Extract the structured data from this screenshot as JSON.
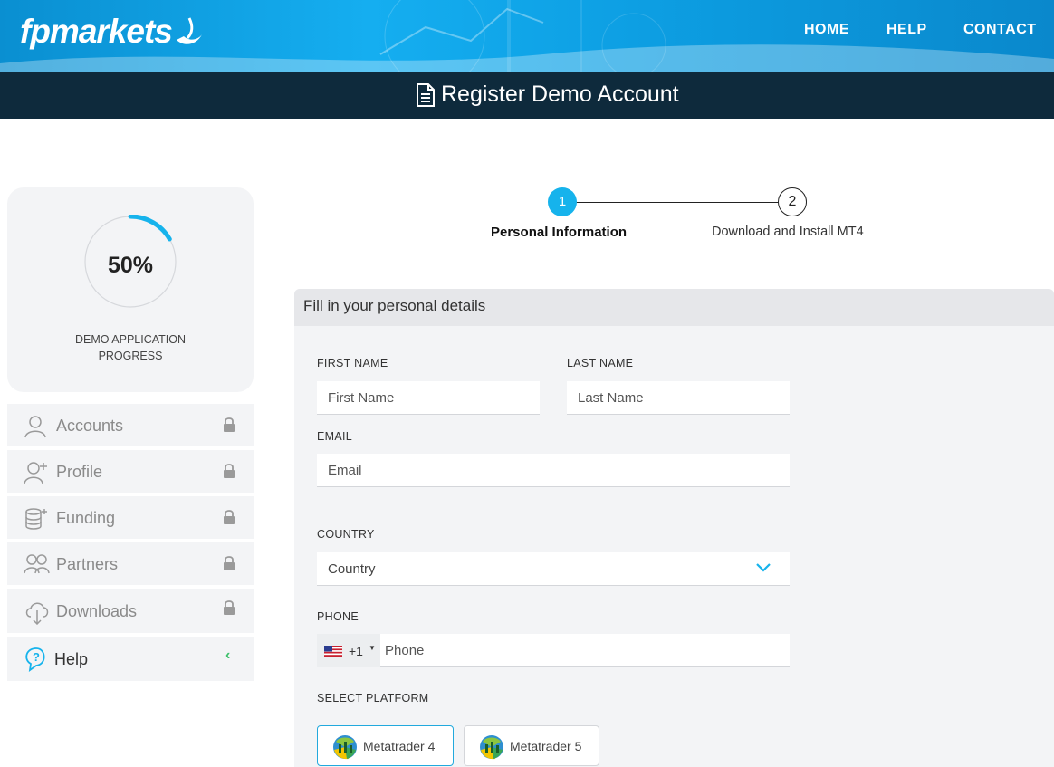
{
  "header": {
    "logo_text": "fpmarkets",
    "nav": {
      "home": "HOME",
      "help": "HELP",
      "contact": "CONTACT"
    },
    "page_title": "Register Demo Account"
  },
  "sidebar": {
    "progress": {
      "value_text": "50%",
      "value": 0.5,
      "label_line1": "DEMO APPLICATION",
      "label_line2": "PROGRESS"
    },
    "items": [
      {
        "label": "Accounts",
        "icon": "user-icon",
        "locked": true
      },
      {
        "label": "Profile",
        "icon": "add-user-icon",
        "locked": true
      },
      {
        "label": "Funding",
        "icon": "coins-icon",
        "locked": true
      },
      {
        "label": "Partners",
        "icon": "partners-icon",
        "locked": true
      },
      {
        "label": "Downloads",
        "icon": "cloud-download-icon",
        "locked": true
      },
      {
        "label": "Help",
        "icon": "help-bubble-icon",
        "expand_glyph": "‹"
      }
    ]
  },
  "stepper": {
    "steps": [
      {
        "number": "1",
        "label": "Personal Information",
        "active": true
      },
      {
        "number": "2",
        "label": "Download and Install MT4",
        "active": false
      }
    ]
  },
  "form": {
    "heading": "Fill in your personal details",
    "first_name": {
      "label": "FIRST NAME",
      "placeholder": "First Name",
      "value": ""
    },
    "last_name": {
      "label": "LAST NAME",
      "placeholder": "Last Name",
      "value": ""
    },
    "email": {
      "label": "EMAIL",
      "placeholder": "Email",
      "value": ""
    },
    "country": {
      "label": "COUNTRY",
      "selected": "Country"
    },
    "phone": {
      "label": "PHONE",
      "dial_code": "+1",
      "placeholder": "Phone",
      "value": ""
    },
    "platform": {
      "label": "SELECT PLATFORM",
      "options": [
        {
          "label": "Metatrader 4",
          "selected": true
        },
        {
          "label": "Metatrader 5",
          "selected": false
        }
      ]
    }
  },
  "colors": {
    "accent": "#16b3ec",
    "header_dark": "#0e2a3c",
    "help_chevron": "#3cc06a"
  }
}
